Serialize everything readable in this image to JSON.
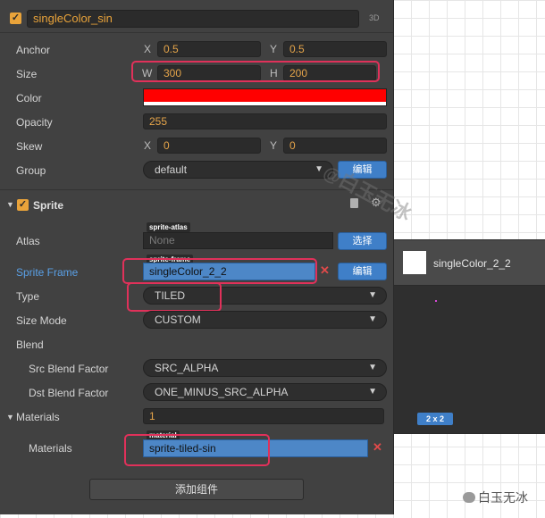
{
  "node": {
    "name": "singleColor_sin",
    "mode_3d": "3D"
  },
  "props": {
    "anchor": {
      "label": "Anchor",
      "x_label": "X",
      "x": "0.5",
      "y_label": "Y",
      "y": "0.5"
    },
    "size": {
      "label": "Size",
      "w_label": "W",
      "w": "300",
      "h_label": "H",
      "h": "200"
    },
    "color": {
      "label": "Color",
      "value_hex": "#ff0000"
    },
    "opacity": {
      "label": "Opacity",
      "value": "255"
    },
    "skew": {
      "label": "Skew",
      "x_label": "X",
      "x": "0",
      "y_label": "Y",
      "y": "0"
    },
    "group": {
      "label": "Group",
      "value": "default",
      "edit": "编辑"
    }
  },
  "sprite": {
    "title": "Sprite",
    "atlas": {
      "label": "Atlas",
      "tag": "sprite-atlas",
      "value": "None",
      "select": "选择"
    },
    "frame": {
      "label": "Sprite Frame",
      "tag": "sprite-frame",
      "value": "singleColor_2_2",
      "edit": "编辑"
    },
    "type": {
      "label": "Type",
      "value": "TILED"
    },
    "size_mode": {
      "label": "Size Mode",
      "value": "CUSTOM"
    },
    "blend": {
      "label": "Blend"
    },
    "src_blend": {
      "label": "Src Blend Factor",
      "value": "SRC_ALPHA"
    },
    "dst_blend": {
      "label": "Dst Blend Factor",
      "value": "ONE_MINUS_SRC_ALPHA"
    },
    "materials_header": {
      "label": "Materials",
      "count": "1"
    },
    "materials_item": {
      "label": "Materials",
      "tag": "material",
      "value": "sprite-tiled-sin"
    },
    "add_component": "添加组件"
  },
  "preview": {
    "title": "singleColor_2_2",
    "size_badge": "2 x 2"
  },
  "watermark": {
    "text": "白玉无冰",
    "footer": "白玉无冰"
  },
  "colors": {
    "accent": "#e9a33a",
    "blue": "#3f7fc8",
    "highlight": "#e0315a",
    "panel": "#414141"
  }
}
